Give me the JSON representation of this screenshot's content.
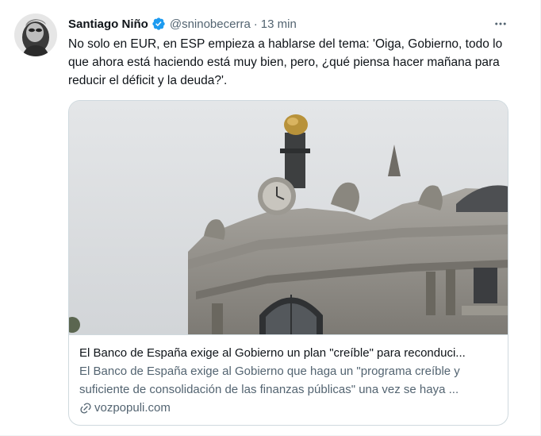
{
  "tweet": {
    "author_name": "Santiago Niño",
    "handle": "@sninobecerra",
    "separator": "·",
    "time": "13 min",
    "more_icon": "more-horizontal-icon",
    "verified_icon": "verified-badge-icon",
    "text": "No solo en EUR, en ESP empieza a hablarse del tema: 'Oiga, Gobierno, todo lo que ahora está haciendo está muy bien, pero, ¿qué piensa hacer mañana para reducir el déficit y la deuda?'.",
    "colors": {
      "verified": "#1d9bf0",
      "text": "#0f1419",
      "secondary": "#536471",
      "border": "#cfd9de"
    }
  },
  "card": {
    "title": "El Banco de España exige al Gobierno un plan \"creíble\" para reconduci...",
    "description": "El Banco de España exige al Gobierno que haga un \"programa creíble y suficiente de consolidación de las finanzas públicas\" una vez se haya ...",
    "domain": "vozpopuli.com",
    "link_icon": "link-icon"
  }
}
